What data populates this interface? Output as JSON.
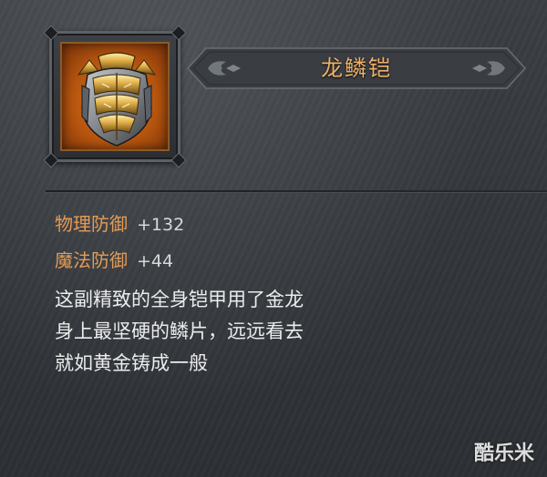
{
  "item": {
    "name": "龙鳞铠",
    "icon": "dragon-scale-armor-icon",
    "stats": [
      {
        "label": "物理防御",
        "value": "+132"
      },
      {
        "label": "魔法防御",
        "value": "+44"
      }
    ],
    "description_lines": [
      "这副精致的全身铠甲用了金龙",
      "身上最坚硬的鳞片，远远看去",
      "就如黄金铸成一般"
    ]
  },
  "watermark": "酷乐米",
  "colors": {
    "title": "#f0b06a",
    "stat_label": "#e59b55",
    "stat_value": "#d8d8d8",
    "description": "#ececec",
    "icon_background": "#c0601a"
  }
}
